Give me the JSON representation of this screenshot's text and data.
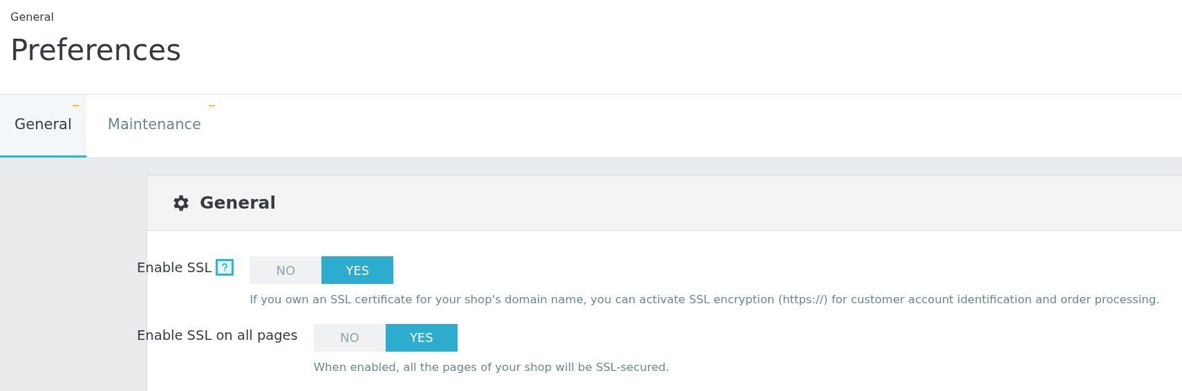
{
  "breadcrumb": "General",
  "title": "Preferences",
  "tabs": [
    {
      "label": "General",
      "selected": true
    },
    {
      "label": "Maintenance",
      "selected": false
    }
  ],
  "panel": {
    "title": "General",
    "rows": [
      {
        "label": "Enable SSL",
        "help": true,
        "options": [
          {
            "label": "NO",
            "selected": false
          },
          {
            "label": "YES",
            "selected": true
          }
        ],
        "hint": "If you own an SSL certificate for your shop's domain name, you can activate SSL encryption (https://) for customer account identification and order processing."
      },
      {
        "label": "Enable SSL on all pages",
        "help": false,
        "options": [
          {
            "label": "NO",
            "selected": false
          },
          {
            "label": "YES",
            "selected": true
          }
        ],
        "hint": "When enabled, all the pages of your shop will be SSL-secured."
      }
    ]
  }
}
